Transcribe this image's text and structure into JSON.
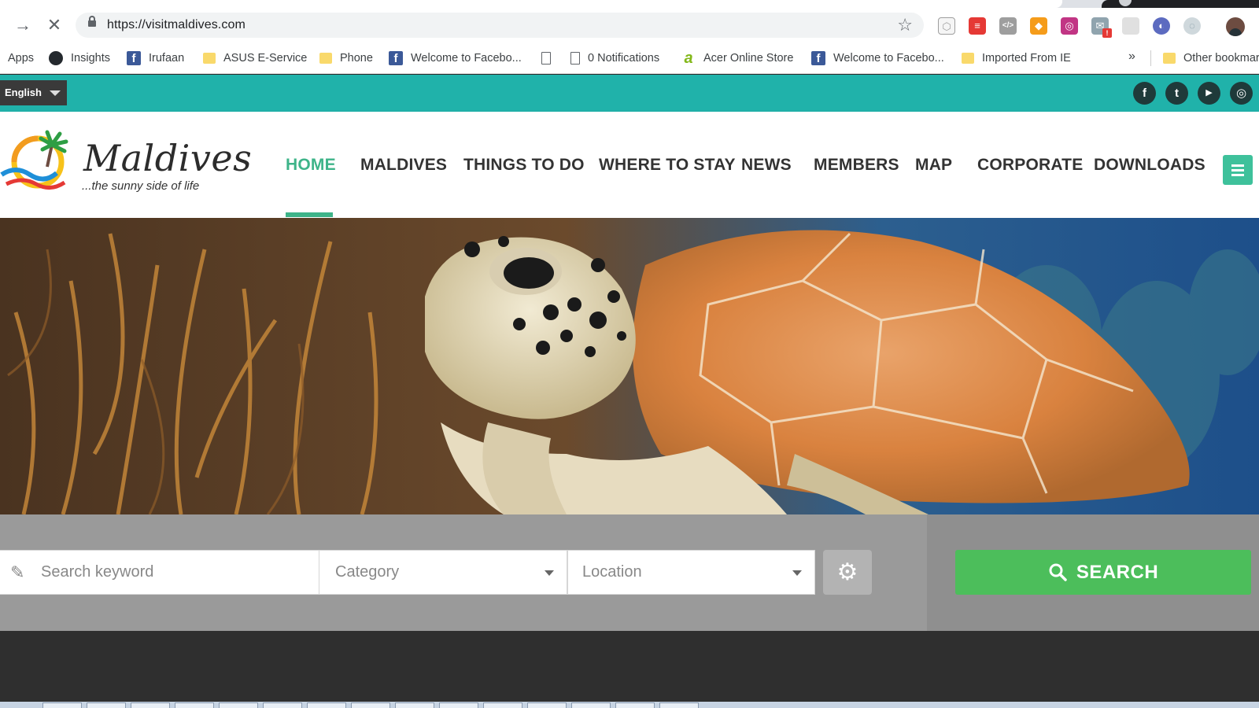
{
  "browser": {
    "url": "https://visitmaldives.com",
    "bookmarks": [
      {
        "label": "Apps",
        "icon": "apps-grid-icon"
      },
      {
        "label": "Insights",
        "icon": "github-icon"
      },
      {
        "label": "Irufaan",
        "icon": "facebook-icon"
      },
      {
        "label": "ASUS E-Service",
        "icon": "folder-icon"
      },
      {
        "label": "Phone",
        "icon": "folder-icon"
      },
      {
        "label": "Welcome to Facebo...",
        "icon": "facebook-icon"
      },
      {
        "label": "",
        "icon": "page-icon"
      },
      {
        "label": "0 Notifications",
        "icon": "page-icon"
      },
      {
        "label": "Acer Online Store",
        "icon": "acer-icon"
      },
      {
        "label": "Welcome to Facebo...",
        "icon": "facebook-icon"
      },
      {
        "label": "Imported From IE",
        "icon": "folder-icon"
      },
      {
        "label": "Other bookmarks",
        "icon": "folder-icon"
      }
    ],
    "more_bookmarks": "»"
  },
  "site": {
    "language": "English",
    "social": [
      {
        "name": "facebook",
        "glyph": "f"
      },
      {
        "name": "twitter",
        "glyph": "t"
      },
      {
        "name": "youtube",
        "glyph": "▶"
      },
      {
        "name": "instagram",
        "glyph": "◎"
      }
    ],
    "logo": {
      "name": "Maldives",
      "tagline": "...the sunny side of life"
    },
    "nav": [
      "HOME",
      "MALDIVES",
      "THINGS TO DO",
      "WHERE TO STAY",
      "NEWS",
      "MEMBERS",
      "MAP",
      "CORPORATE",
      "DOWNLOADS"
    ],
    "active_nav": "HOME",
    "search": {
      "keyword_placeholder": "Search keyword",
      "category_placeholder": "Category",
      "location_placeholder": "Location",
      "button_label": "SEARCH"
    },
    "colors": {
      "topbar": "#20b2aa",
      "accent": "#3eb489",
      "search_button": "#4cbe5b"
    }
  }
}
